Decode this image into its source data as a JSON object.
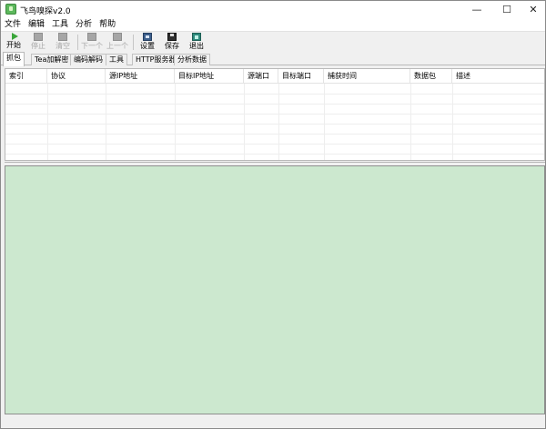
{
  "window": {
    "title": "飞鸟嗅探v2.0",
    "controls": {
      "minimize": "—",
      "maximize": "☐",
      "close": "✕"
    }
  },
  "menu": {
    "items": [
      "文件",
      "编辑",
      "工具",
      "分析",
      "帮助"
    ]
  },
  "toolbar": {
    "buttons": [
      {
        "label": "开始",
        "icon": "play-icon",
        "enabled": true
      },
      {
        "label": "停止",
        "icon": "stop-icon",
        "enabled": false
      },
      {
        "label": "清空",
        "icon": "clear-icon",
        "enabled": false
      },
      {
        "label": "下一个",
        "icon": "next-icon",
        "enabled": false
      },
      {
        "label": "上一个",
        "icon": "prev-icon",
        "enabled": false
      },
      {
        "label": "设置",
        "icon": "settings-icon",
        "enabled": true
      },
      {
        "label": "保存",
        "icon": "save-icon",
        "enabled": true
      },
      {
        "label": "退出",
        "icon": "exit-icon",
        "enabled": true
      }
    ]
  },
  "tabs": {
    "items": [
      "抓包",
      "Tea加解密",
      "编码解码",
      "工具",
      "HTTP服务器",
      "分析数据"
    ],
    "active": "抓包"
  },
  "table": {
    "columns": [
      "索引",
      "协议",
      "源IP地址",
      "目标IP地址",
      "源端口",
      "目标端口",
      "捕获时间",
      "数据包",
      "描述"
    ],
    "rows": []
  },
  "colors": {
    "detail_background": "#cce8cf",
    "window_background": "#f0f0f0",
    "table_background": "#ffffff"
  }
}
